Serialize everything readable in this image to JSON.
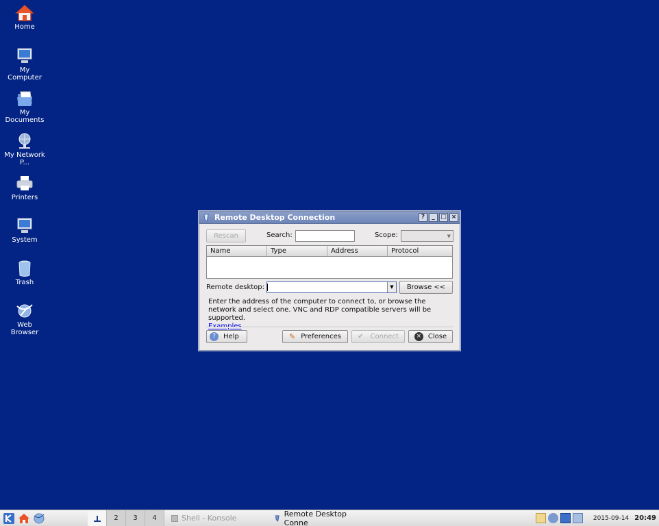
{
  "desktop": {
    "icons": [
      {
        "label": "Home",
        "icon": "home-icon"
      },
      {
        "label": "My Computer",
        "icon": "computer-icon"
      },
      {
        "label": "My Documents",
        "icon": "documents-icon"
      },
      {
        "label": "My Network P...",
        "icon": "network-icon"
      },
      {
        "label": "Printers",
        "icon": "printer-icon"
      },
      {
        "label": "System",
        "icon": "system-icon"
      },
      {
        "label": "Trash",
        "icon": "trash-icon"
      },
      {
        "label": "Web Browser",
        "icon": "web-browser-icon"
      }
    ],
    "background_color": "#032484"
  },
  "dialog": {
    "title": "Remote Desktop Connection",
    "title_buttons": [
      "?",
      "_",
      "□",
      "×"
    ],
    "rescan_label": "Rescan",
    "search_label": "Search:",
    "search_value": "",
    "scope_label": "Scope:",
    "scope_value": "",
    "columns": [
      "Name",
      "Type",
      "Address",
      "Protocol"
    ],
    "remote_desktop_label": "Remote desktop:",
    "remote_desktop_value": "",
    "browse_label": "Browse <<",
    "description": "Enter the address of the computer to connect to, or browse the network and select one. VNC and RDP compatible servers will be supported.",
    "examples_link": "Examples",
    "help_label": "Help",
    "preferences_label": "Preferences",
    "connect_label": "Connect",
    "close_label": "Close"
  },
  "taskbar": {
    "pager": [
      "1",
      "2",
      "3",
      "4"
    ],
    "tasks": [
      {
        "label": "Shell - Konsole",
        "active": false
      },
      {
        "label": "Remote Desktop Conne",
        "active": true
      }
    ],
    "date": "2015-09-14",
    "time": "20:49"
  }
}
